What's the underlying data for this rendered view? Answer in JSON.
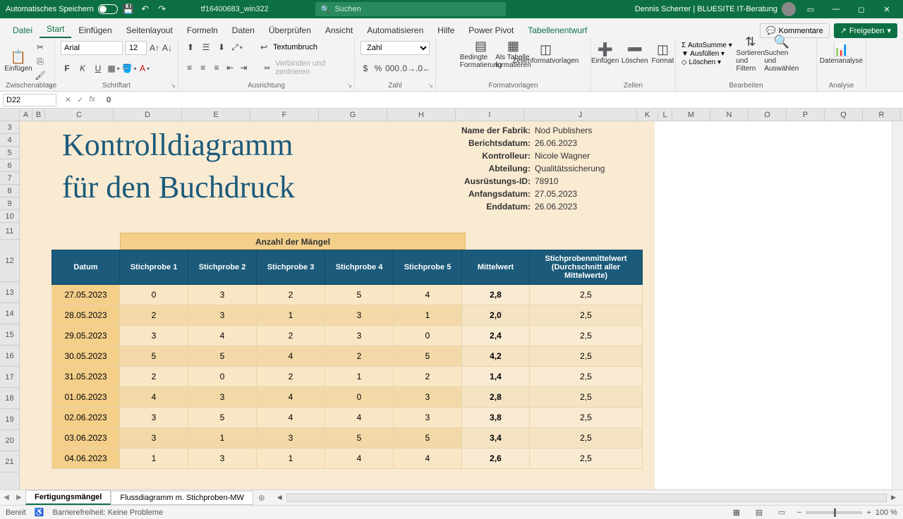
{
  "titlebar": {
    "autosave": "Automatisches Speichern",
    "filename": "tf16400683_win322",
    "search_placeholder": "Suchen",
    "user": "Dennis Scherrer | BLUESITE IT-Beratung"
  },
  "menu": {
    "tabs": [
      "Datei",
      "Start",
      "Einfügen",
      "Seitenlayout",
      "Formeln",
      "Daten",
      "Überprüfen",
      "Ansicht",
      "Automatisieren",
      "Hilfe",
      "Power Pivot",
      "Tabellenentwurf"
    ],
    "comments": "Kommentare",
    "share": "Freigeben"
  },
  "ribbon": {
    "paste": "Einfügen",
    "clipboard": "Zwischenablage",
    "font": "Arial",
    "size": "12",
    "fontgroup": "Schriftart",
    "wrap": "Textumbruch",
    "merge": "Verbinden und zentrieren",
    "aligngroup": "Ausrichtung",
    "numberformat": "Zahl",
    "numbergroup": "Zahl",
    "condfmt": "Bedingte Formatierung",
    "astable": "Als Tabelle formatieren",
    "cellstyles": "Zellenformatvorlagen",
    "stylesgroup": "Formatvorlagen",
    "insert": "Einfügen",
    "delete": "Löschen",
    "format": "Format",
    "cellsgroup": "Zellen",
    "autosum": "AutoSumme",
    "fill": "Ausfüllen",
    "clear": "Löschen",
    "sort": "Sortieren und Filtern",
    "find": "Suchen und Auswählen",
    "editgroup": "Bearbeiten",
    "analyze": "Datenanalyse",
    "analyzegroup": "Analyse"
  },
  "fx": {
    "cell": "D22",
    "value": "0"
  },
  "columns": [
    "A",
    "B",
    "C",
    "D",
    "E",
    "F",
    "G",
    "H",
    "I",
    "J",
    "K",
    "L",
    "M",
    "N",
    "O",
    "P",
    "Q",
    "R"
  ],
  "rows": [
    "3",
    "4",
    "5",
    "6",
    "7",
    "8",
    "9",
    "10",
    "11",
    "12",
    "13",
    "14",
    "15",
    "16",
    "17",
    "18",
    "19",
    "20",
    "21"
  ],
  "doc": {
    "title1": "Kontrolldiagramm",
    "title2": "für den Buchdruck",
    "meta": [
      {
        "label": "Name der Fabrik:",
        "value": "Nod Publishers"
      },
      {
        "label": "Berichtsdatum:",
        "value": "26.06.2023"
      },
      {
        "label": "Kontrolleur:",
        "value": "Nicole Wagner"
      },
      {
        "label": "Abteilung:",
        "value": "Qualitätssicherung"
      },
      {
        "label": "Ausrüstungs-ID:",
        "value": "78910"
      },
      {
        "label": "Anfangsdatum:",
        "value": "27.05.2023"
      },
      {
        "label": "Enddatum:",
        "value": "26.06.2023"
      }
    ],
    "subheader": "Anzahl der Mängel",
    "headers": [
      "Datum",
      "Stichprobe 1",
      "Stichprobe 2",
      "Stichprobe 3",
      "Stichprobe 4",
      "Stichprobe 5",
      "Mittelwert",
      "Stichprobenmittelwert (Durchschnitt aller Mittelwerte)"
    ]
  },
  "chart_data": {
    "type": "table",
    "title": "Kontrolldiagramm für den Buchdruck – Anzahl der Mängel",
    "columns": [
      "Datum",
      "Stichprobe 1",
      "Stichprobe 2",
      "Stichprobe 3",
      "Stichprobe 4",
      "Stichprobe 5",
      "Mittelwert",
      "Stichprobenmittelwert"
    ],
    "rows": [
      [
        "27.05.2023",
        "0",
        "3",
        "2",
        "5",
        "4",
        "2,8",
        "2,5"
      ],
      [
        "28.05.2023",
        "2",
        "3",
        "1",
        "3",
        "1",
        "2,0",
        "2,5"
      ],
      [
        "29.05.2023",
        "3",
        "4",
        "2",
        "3",
        "0",
        "2,4",
        "2,5"
      ],
      [
        "30.05.2023",
        "5",
        "5",
        "4",
        "2",
        "5",
        "4,2",
        "2,5"
      ],
      [
        "31.05.2023",
        "2",
        "0",
        "2",
        "1",
        "2",
        "1,4",
        "2,5"
      ],
      [
        "01.06.2023",
        "4",
        "3",
        "4",
        "0",
        "3",
        "2,8",
        "2,5"
      ],
      [
        "02.06.2023",
        "3",
        "5",
        "4",
        "4",
        "3",
        "3,8",
        "2,5"
      ],
      [
        "03.06.2023",
        "3",
        "1",
        "3",
        "5",
        "5",
        "3,4",
        "2,5"
      ],
      [
        "04.06.2023",
        "1",
        "3",
        "1",
        "4",
        "4",
        "2,6",
        "2,5"
      ]
    ]
  },
  "sheets": {
    "tab1": "Fertigungsmängel",
    "tab2": "Flussdiagramm m. Stichproben-MW"
  },
  "status": {
    "ready": "Bereit",
    "access": "Barrierefreiheit: Keine Probleme",
    "zoom": "100 %"
  }
}
